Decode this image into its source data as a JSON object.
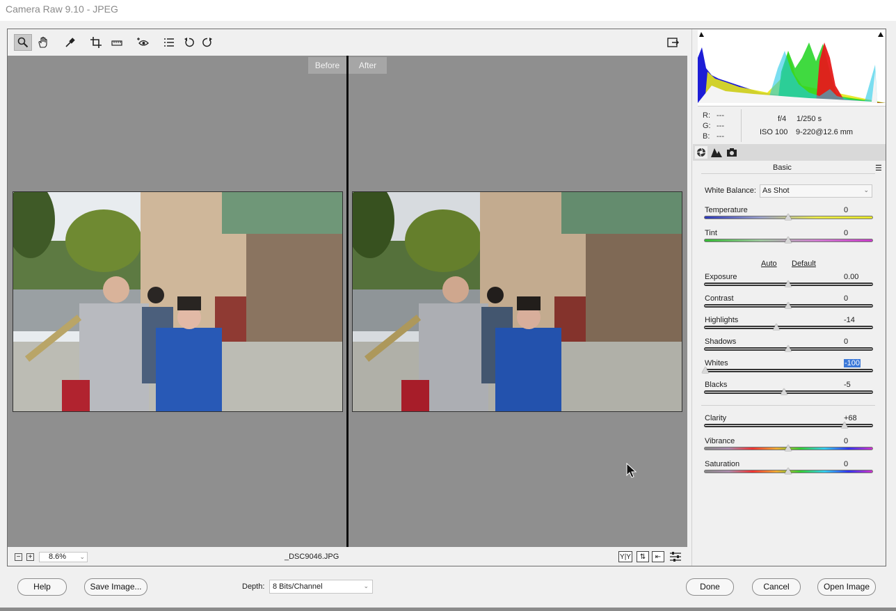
{
  "window": {
    "title": "Camera Raw 9.10  -  JPEG"
  },
  "toolbar": {
    "tools": [
      "zoom-icon",
      "hand-icon",
      "white-balance-icon",
      "crop-icon",
      "straighten-icon",
      "red-eye-icon",
      "presets-list-icon",
      "rotate-left-icon",
      "rotate-right-icon"
    ],
    "fullscreen_icon": "toggle-fullscreen-icon"
  },
  "preview": {
    "before_label": "Before",
    "after_label": "After"
  },
  "statusbar": {
    "zoom_minus": "−",
    "zoom_plus": "+",
    "zoom_value": "8.6%",
    "filename": "_DSC9046.JPG",
    "view_icons": [
      "before-after-view-icon",
      "swap-settings-icon",
      "copy-settings-icon",
      "toggle-settings-icon"
    ]
  },
  "info": {
    "r_label": "R:",
    "r_value": "---",
    "g_label": "G:",
    "g_value": "---",
    "b_label": "B:",
    "b_value": "---",
    "aperture": "f/4",
    "shutter": "1/250 s",
    "iso": "ISO 100",
    "lens": "9-220@12.6 mm"
  },
  "panel": {
    "title": "Basic",
    "tabs": [
      "basic-tab-icon",
      "tone-curve-tab-icon",
      "camera-calibration-tab-icon"
    ],
    "white_balance_label": "White Balance:",
    "white_balance_value": "As Shot",
    "auto_label": "Auto",
    "default_label": "Default",
    "sliders": [
      {
        "key": "temperature",
        "label": "Temperature",
        "value": "0",
        "min": -100,
        "max": 100,
        "num": 0
      },
      {
        "key": "tint",
        "label": "Tint",
        "value": "0",
        "min": -150,
        "max": 150,
        "num": 0
      },
      {
        "key": "exposure",
        "label": "Exposure",
        "value": "0.00",
        "min": -5,
        "max": 5,
        "num": 0
      },
      {
        "key": "contrast",
        "label": "Contrast",
        "value": "0",
        "min": -100,
        "max": 100,
        "num": 0
      },
      {
        "key": "highlights",
        "label": "Highlights",
        "value": "-14",
        "min": -100,
        "max": 100,
        "num": -14
      },
      {
        "key": "shadows",
        "label": "Shadows",
        "value": "0",
        "min": -100,
        "max": 100,
        "num": 0
      },
      {
        "key": "whites",
        "label": "Whites",
        "value": "-100",
        "min": -100,
        "max": 100,
        "num": -100,
        "selected": true
      },
      {
        "key": "blacks",
        "label": "Blacks",
        "value": "-5",
        "min": -100,
        "max": 100,
        "num": -5
      },
      {
        "key": "clarity",
        "label": "Clarity",
        "value": "+68",
        "min": -100,
        "max": 100,
        "num": 68
      },
      {
        "key": "vibrance",
        "label": "Vibrance",
        "value": "0",
        "min": -100,
        "max": 100,
        "num": 0
      },
      {
        "key": "saturation",
        "label": "Saturation",
        "value": "0",
        "min": -100,
        "max": 100,
        "num": 0
      }
    ]
  },
  "footer": {
    "help_label": "Help",
    "save_label": "Save Image...",
    "depth_label": "Depth:",
    "depth_value": "8 Bits/Channel",
    "done_label": "Done",
    "cancel_label": "Cancel",
    "open_label": "Open Image"
  }
}
